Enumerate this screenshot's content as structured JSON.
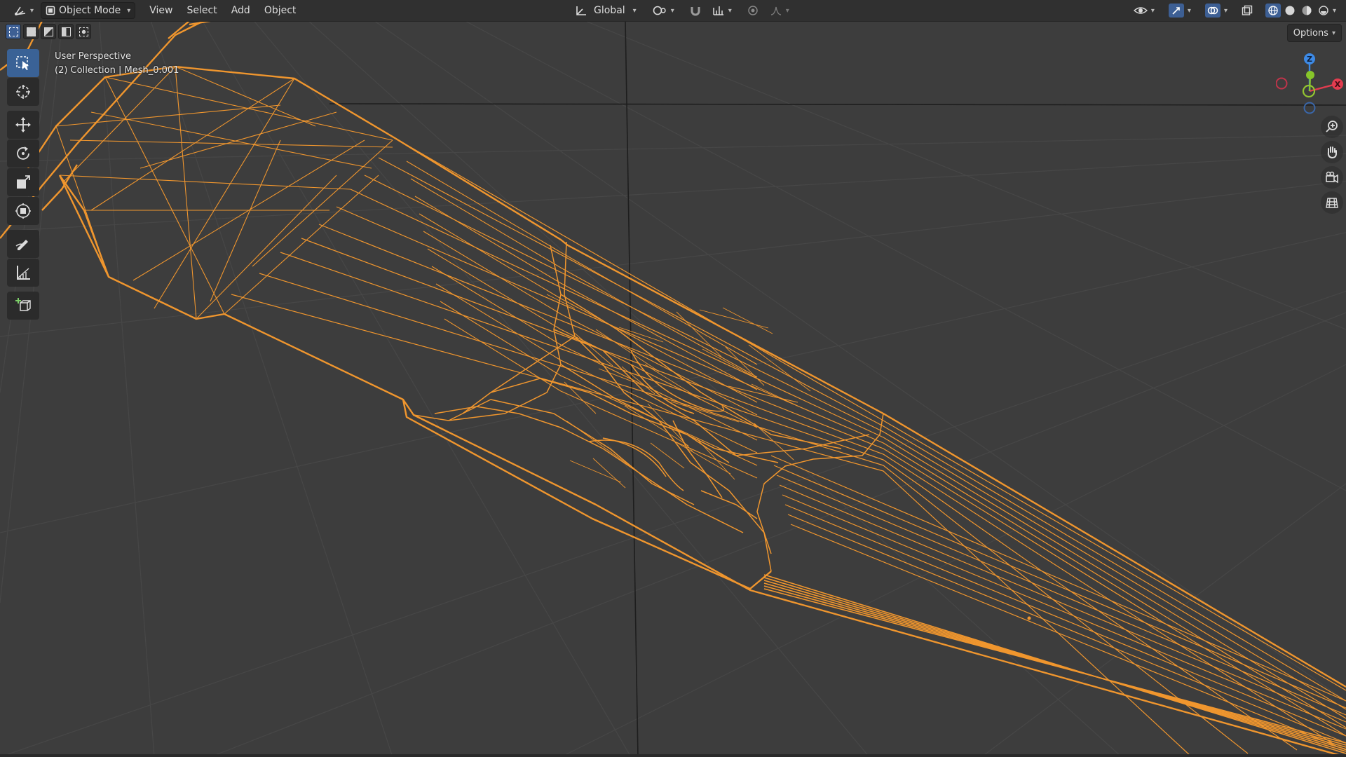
{
  "header": {
    "editor_type_icon": "editor-type-icon",
    "mode": {
      "label": "Object Mode",
      "icon": "object-mode-icon"
    },
    "menus": [
      "View",
      "Select",
      "Add",
      "Object"
    ],
    "transform_orientation": {
      "label": "Global",
      "icon": "transform-orientation-icon"
    },
    "pivot_icon": "pivot-point-icon",
    "snap_icon": "magnet-icon",
    "snap_increment_icon": "snap-increment-icon",
    "proportional_icon": "proportional-edit-icon",
    "falloff_icon": "falloff-curve-icon",
    "right_icons": [
      "visibility-eye-icon",
      "gizmo-toggle-icon",
      "overlay-toggle-icon",
      "xray-toggle-icon",
      "shading-wireframe-icon",
      "shading-solid-icon",
      "shading-material-icon",
      "shading-rendered-icon"
    ]
  },
  "viewport": {
    "view_name": "User Perspective",
    "collection_info": "(2) Collection | Mesh_0.001",
    "options_label": "Options",
    "wire_color": "#f0962e",
    "grid_color": "#474747",
    "background_color": "#3d3d3d"
  },
  "select_modes": [
    "select-new-icon",
    "select-extend-icon",
    "select-subtract-icon",
    "select-invert-icon",
    "select-intersect-icon"
  ],
  "toolbar": {
    "tools": [
      {
        "name": "select-box",
        "icon": "select-box-icon",
        "active": true
      },
      {
        "name": "cursor",
        "icon": "cursor-icon",
        "active": false
      },
      {
        "name": "move",
        "icon": "move-icon",
        "active": false
      },
      {
        "name": "rotate",
        "icon": "rotate-icon",
        "active": false
      },
      {
        "name": "scale",
        "icon": "scale-icon",
        "active": false
      },
      {
        "name": "transform",
        "icon": "transform-icon",
        "active": false
      },
      {
        "name": "annotate",
        "icon": "annotate-icon",
        "active": false
      },
      {
        "name": "measure",
        "icon": "measure-icon",
        "active": false
      },
      {
        "name": "add-cube",
        "icon": "add-cube-icon",
        "active": false
      }
    ]
  },
  "navigation_tools": [
    "zoom-icon",
    "pan-hand-icon",
    "camera-view-icon",
    "ortho-grid-icon"
  ],
  "gizmo": {
    "z_label": "Z",
    "x_label": "X",
    "x_color": "#e23c4f",
    "y_color": "#87c52a",
    "z_color": "#3d8ae6",
    "neg_z_color": "#3a66a8",
    "neg_x_color": "#c0344a",
    "y_ring_color": "#93c531"
  }
}
